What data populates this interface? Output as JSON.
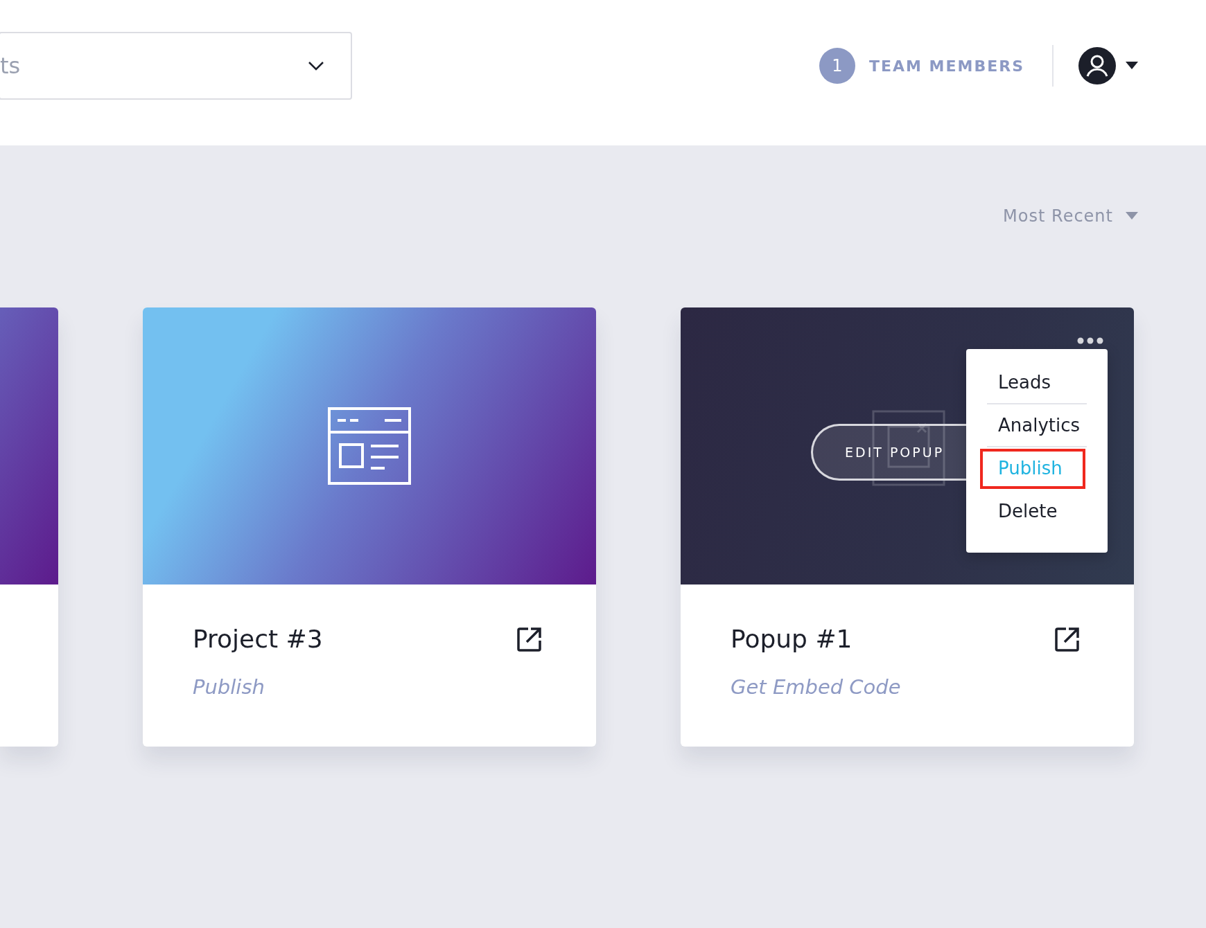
{
  "header": {
    "project_select": {
      "value": "ts"
    },
    "team": {
      "count": "1",
      "label": "TEAM MEMBERS"
    }
  },
  "sort": {
    "label": "Most Recent"
  },
  "cards": [
    {
      "kind": "project",
      "cut_off": true
    },
    {
      "kind": "project",
      "cut_off": false,
      "title": "Project #3",
      "action": "Publish"
    },
    {
      "kind": "popup",
      "cut_off": false,
      "title": "Popup #1",
      "action": "Get Embed Code",
      "edit_label": "EDIT POPUP",
      "menu": [
        {
          "label": "Leads",
          "selected": false,
          "highlighted": false
        },
        {
          "label": "Analytics",
          "selected": false,
          "highlighted": false
        },
        {
          "label": "Publish",
          "selected": true,
          "highlighted": true
        },
        {
          "label": "Delete",
          "selected": false,
          "highlighted": false
        }
      ]
    }
  ]
}
